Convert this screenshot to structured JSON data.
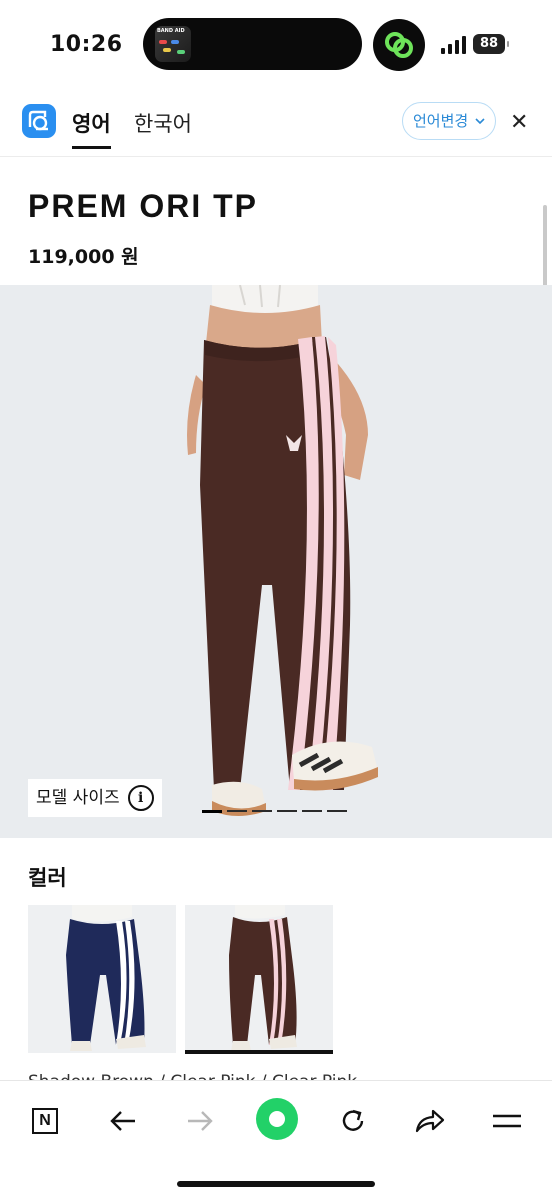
{
  "status_bar": {
    "time": "10:26",
    "battery": "88",
    "island_thumb_text": "BAND AID"
  },
  "translate_bar": {
    "tab_english": "영어",
    "tab_korean": "한국어",
    "change_language": "언어변경",
    "close_glyph": "✕",
    "accent_color": "#2b8ad6"
  },
  "product": {
    "title": "PREM ORI TP",
    "price": "119,000 원"
  },
  "hero": {
    "model_size_label": "모델 사이즈",
    "info_glyph": "i",
    "carousel_pages": 6,
    "carousel_active": 1
  },
  "color_section": {
    "heading": "컬러",
    "swatches": [
      {
        "name": "navy-pants",
        "color": "#1f2a5a",
        "stripe": "#ffffff",
        "selected": false
      },
      {
        "name": "brown-pants",
        "color": "#4a2a24",
        "stripe": "#f6d3da",
        "selected": true
      }
    ],
    "selected_color_name": "Shadow Brown / Clear Pink / Clear Pink"
  },
  "bottom_bar": {
    "n_label": "N",
    "items": [
      "n-icon",
      "back-icon",
      "forward-icon",
      "home-icon",
      "refresh-icon",
      "share-icon",
      "menu-icon"
    ]
  }
}
